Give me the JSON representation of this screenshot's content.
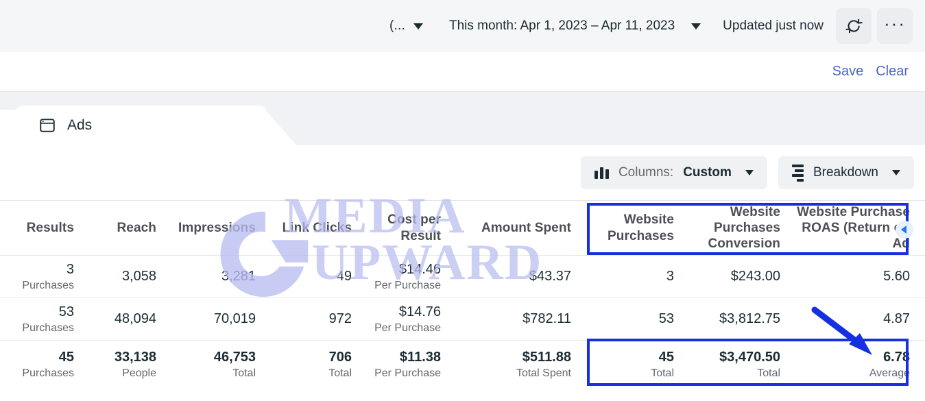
{
  "toolbar": {
    "truncated_filter": "(...",
    "date_range": "This month: Apr 1, 2023 – Apr 11, 2023",
    "updated_status": "Updated just now",
    "refresh_icon": "refresh-icon",
    "more_icon": "ellipsis-icon",
    "caret_icon": "chevron-down-icon"
  },
  "filter_bar": {
    "save_label": "Save",
    "clear_label": "Clear"
  },
  "tabs": [
    {
      "label": "Ads",
      "icon": "window-icon",
      "active": true
    }
  ],
  "controls": {
    "columns_prefix": "Columns:",
    "columns_value": "Custom",
    "columns_icon": "columns-icon",
    "breakdown_label": "Breakdown",
    "breakdown_icon": "breakdown-icon"
  },
  "table": {
    "headers": [
      "Results",
      "Reach",
      "Impressions",
      "Link Clicks",
      "Cost per Result",
      "Amount Spent",
      "Website Purchases",
      "Website Purchases Conversion",
      "Website Purchase ROAS (Return on Ad"
    ],
    "rows": [
      {
        "type": "data",
        "cells": [
          {
            "value": "3",
            "sub": "Purchases"
          },
          {
            "value": "3,058",
            "sub": ""
          },
          {
            "value": "3,281",
            "sub": ""
          },
          {
            "value": "49",
            "sub": ""
          },
          {
            "value": "$14.46",
            "sub": "Per Purchase"
          },
          {
            "value": "$43.37",
            "sub": ""
          },
          {
            "value": "3",
            "sub": ""
          },
          {
            "value": "$243.00",
            "sub": ""
          },
          {
            "value": "5.60",
            "sub": ""
          }
        ]
      },
      {
        "type": "data",
        "cells": [
          {
            "value": "53",
            "sub": "Purchases"
          },
          {
            "value": "48,094",
            "sub": ""
          },
          {
            "value": "70,019",
            "sub": ""
          },
          {
            "value": "972",
            "sub": ""
          },
          {
            "value": "$14.76",
            "sub": "Per Purchase"
          },
          {
            "value": "$782.11",
            "sub": ""
          },
          {
            "value": "53",
            "sub": ""
          },
          {
            "value": "$3,812.75",
            "sub": ""
          },
          {
            "value": "4.87",
            "sub": ""
          }
        ]
      },
      {
        "type": "total",
        "cells": [
          {
            "value": "45",
            "sub": "Purchases"
          },
          {
            "value": "33,138",
            "sub": "People"
          },
          {
            "value": "46,753",
            "sub": "Total"
          },
          {
            "value": "706",
            "sub": "Total"
          },
          {
            "value": "$11.38",
            "sub": "Per Purchase"
          },
          {
            "value": "$511.88",
            "sub": "Total Spent"
          },
          {
            "value": "45",
            "sub": "Total"
          },
          {
            "value": "$3,470.50",
            "sub": "Total"
          },
          {
            "value": "6.78",
            "sub": "Average"
          }
        ]
      }
    ],
    "scroll_right_icon": "chevron-left-circle-icon"
  },
  "annotations": {
    "highlight_color": "#1430e0",
    "arrow_icon": "arrow-down-right-icon",
    "highlighted_header_label": "Website Purchase ROAS column group",
    "highlighted_total_label": "Total row ROAS values"
  },
  "watermark": {
    "line1": "MEDIA",
    "line2": "UPWARD",
    "color": "#b9bdf0"
  }
}
